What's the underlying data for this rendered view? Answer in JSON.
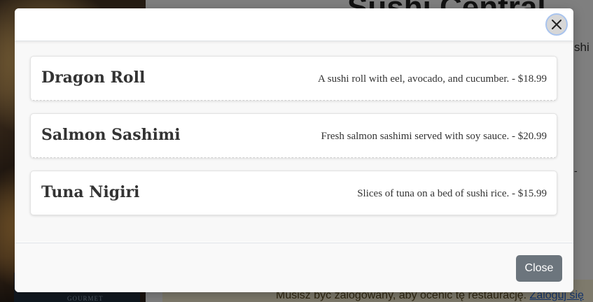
{
  "background": {
    "title_partial": "Sushi Central",
    "snippet_top": "shi",
    "snippet_mid": "-",
    "login_notice": "Musisz być zalogowany, aby ocenić tę restaurację.",
    "login_link": "Zaloguj się",
    "image_caption": "GOURMET"
  },
  "modal": {
    "close_icon": "close-icon",
    "items": [
      {
        "name": "Dragon Roll",
        "description": "A sushi roll with eel, avocado, and cucumber.",
        "price": "$18.99",
        "line": "A sushi roll with eel, avocado, and cucumber. - $18.99"
      },
      {
        "name": "Salmon Sashimi",
        "description": "Fresh salmon sashimi served with soy sauce.",
        "price": "$20.99",
        "line": "Fresh salmon sashimi served with soy sauce. - $20.99"
      },
      {
        "name": "Tuna Nigiri",
        "description": "Slices of tuna on a bed of sushi rice.",
        "price": "$15.99",
        "line": "Slices of tuna on a bed of sushi rice. - $15.99"
      }
    ],
    "footer": {
      "close_label": "Close"
    }
  },
  "colors": {
    "close_button_bg": "#6c757d",
    "backdrop": "rgba(0,0,0,0.5)",
    "link": "#2a6ad6"
  }
}
